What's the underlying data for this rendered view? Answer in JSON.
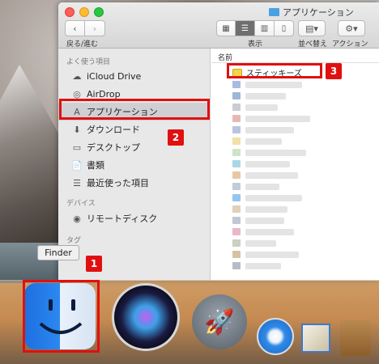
{
  "window": {
    "title": "アプリケーション",
    "toolbar": {
      "back_forward_label": "戻る/進む",
      "view_label": "表示",
      "arrange_label": "並べ替え",
      "action_label": "アクション"
    }
  },
  "sidebar": {
    "favorites_header": "よく使う項目",
    "items": [
      {
        "label": "iCloud Drive",
        "icon": "cloud-icon"
      },
      {
        "label": "AirDrop",
        "icon": "airdrop-icon"
      },
      {
        "label": "アプリケーション",
        "icon": "applications-icon"
      },
      {
        "label": "ダウンロード",
        "icon": "download-icon"
      },
      {
        "label": "デスクトップ",
        "icon": "desktop-icon"
      },
      {
        "label": "書類",
        "icon": "document-icon"
      },
      {
        "label": "最近使った項目",
        "icon": "recents-icon"
      }
    ],
    "devices_header": "デバイス",
    "devices": [
      {
        "label": "リモートディスク",
        "icon": "disc-icon"
      }
    ],
    "tags_header": "タグ"
  },
  "list": {
    "column_name": "名前",
    "first_item": "スティッキーズ"
  },
  "dock": {
    "tooltip": "Finder",
    "apps": [
      "finder-icon",
      "siri-icon",
      "launchpad-icon",
      "safari-icon",
      "mail-icon",
      "notes-icon"
    ]
  },
  "callouts": {
    "one": "1",
    "two": "2",
    "three": "3"
  },
  "colors": {
    "callout": "#e01010",
    "selection": "#cfcfd4"
  }
}
